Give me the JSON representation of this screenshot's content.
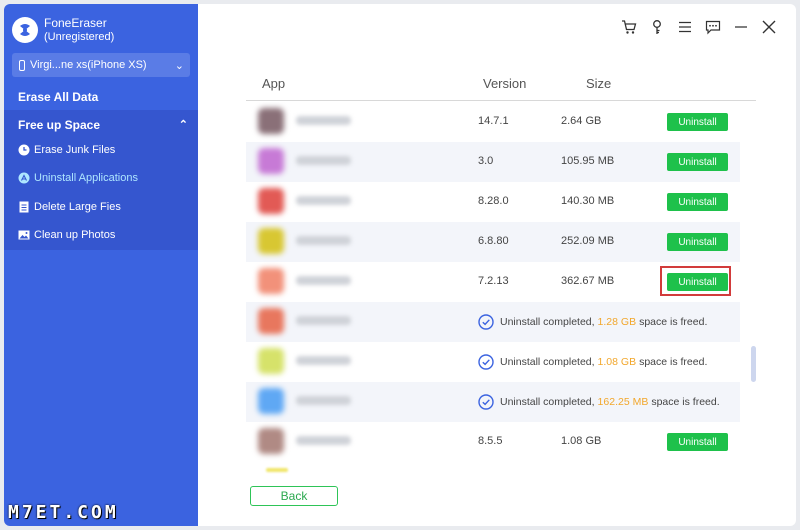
{
  "app": {
    "name": "FoneEraser",
    "status": "(Unregistered)"
  },
  "device": {
    "name": "Virgi...ne xs(iPhone XS)"
  },
  "sidebar": {
    "erase_all": "Erase All Data",
    "free_up": "Free up Space",
    "items": [
      {
        "label": "Erase Junk Files",
        "icon": "clock-icon",
        "active": false
      },
      {
        "label": "Uninstall Applications",
        "icon": "app-store-icon",
        "active": true
      },
      {
        "label": "Delete Large Fies",
        "icon": "document-icon",
        "active": false
      },
      {
        "label": "Clean up Photos",
        "icon": "photo-icon",
        "active": false
      }
    ]
  },
  "table": {
    "headers": {
      "app": "App",
      "version": "Version",
      "size": "Size"
    },
    "uninstall_label": "Uninstall",
    "completed_prefix": "Uninstall completed,",
    "completed_suffix": "space is freed.",
    "rows": [
      {
        "icon_color": "#8a7078",
        "version": "14.7.1",
        "size": "2.64 GB",
        "state": "button"
      },
      {
        "icon_color": "#c77ad6",
        "version": "3.0",
        "size": "105.95 MB",
        "state": "button"
      },
      {
        "icon_color": "#e25a55",
        "version": "8.28.0",
        "size": "140.30 MB",
        "state": "button"
      },
      {
        "icon_color": "#d8c732",
        "version": "6.8.80",
        "size": "252.09 MB",
        "state": "button"
      },
      {
        "icon_color": "#f2917a",
        "version": "7.2.13",
        "size": "362.67 MB",
        "state": "button",
        "highlighted": true
      },
      {
        "icon_color": "#e8775e",
        "state": "done",
        "freed": "1.28 GB"
      },
      {
        "icon_color": "#d6e26a",
        "state": "done",
        "freed": "1.08 GB"
      },
      {
        "icon_color": "#5fa8f4",
        "state": "done",
        "freed": "162.25 MB"
      },
      {
        "icon_color": "#b08a84",
        "version": "8.5.5",
        "size": "1.08 GB",
        "state": "button"
      }
    ]
  },
  "back_label": "Back",
  "watermark": "M7ET.COM",
  "colors": {
    "sidebar": "#3b63e0",
    "accent_green": "#1ec14b",
    "freed_amount": "#f2a72c",
    "highlight": "#d23b3b"
  }
}
